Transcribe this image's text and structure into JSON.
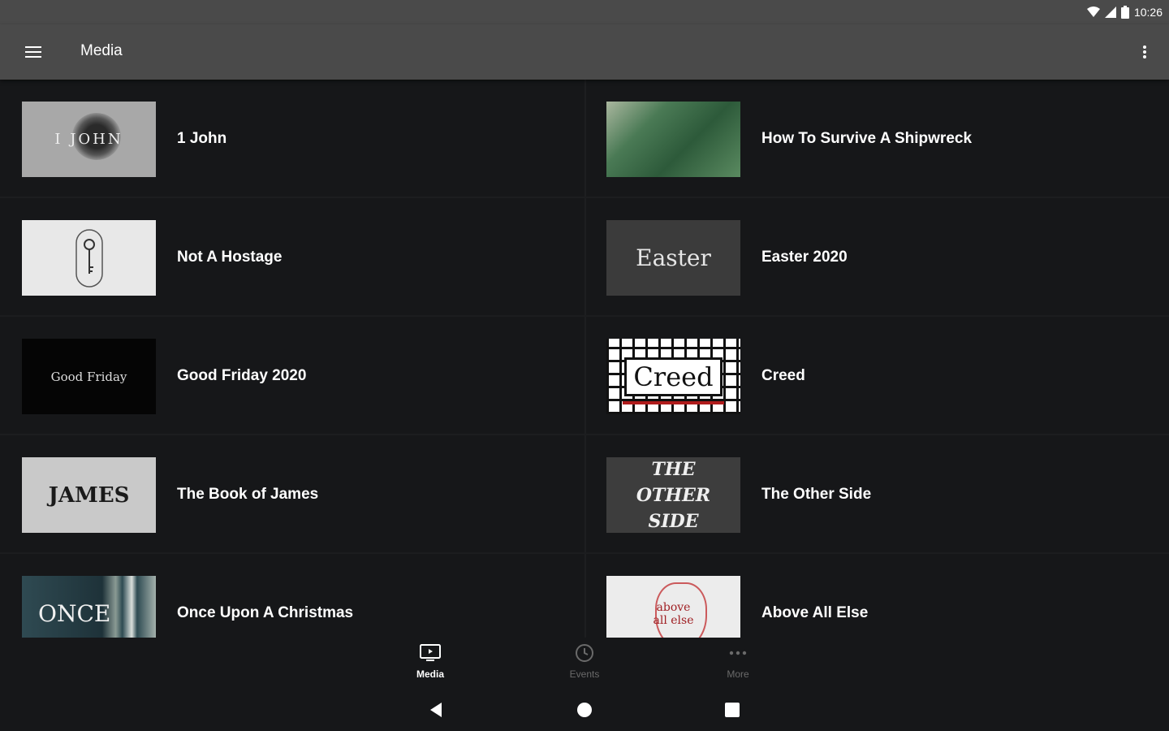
{
  "status_bar": {
    "time": "10:26"
  },
  "app_bar": {
    "title": "Media",
    "menu_icon": "hamburger-menu-icon",
    "overflow_icon": "more-vertical-icon"
  },
  "media_items": [
    {
      "title": "1 John",
      "thumb_text": "I JOHN"
    },
    {
      "title": "How To Survive A Shipwreck",
      "thumb_text": ""
    },
    {
      "title": "Not A Hostage",
      "thumb_text": ""
    },
    {
      "title": "Easter 2020",
      "thumb_text": "Easter"
    },
    {
      "title": "Good Friday 2020",
      "thumb_text": "Good Friday"
    },
    {
      "title": "Creed",
      "thumb_text": "Creed"
    },
    {
      "title": "The Book of James",
      "thumb_text": "JAMES"
    },
    {
      "title": "The Other Side",
      "thumb_text": "THE OTHER SIDE"
    },
    {
      "title": "Once Upon A Christmas",
      "thumb_text": "ONCE"
    },
    {
      "title": "Above All Else",
      "thumb_text": "above all else"
    }
  ],
  "bottom_nav": {
    "tabs": [
      {
        "label": "Media",
        "icon": "tv-icon",
        "active": true
      },
      {
        "label": "Events",
        "icon": "clock-icon",
        "active": false
      },
      {
        "label": "More",
        "icon": "more-horizontal-icon",
        "active": false
      }
    ]
  },
  "system_nav": {
    "back": "back-icon",
    "home": "home-icon",
    "recents": "recents-icon"
  },
  "colors": {
    "app_bar": "#4a4a4a",
    "background": "#161719",
    "active_tab": "#ffffff",
    "inactive_tab": "#6a6a6a"
  }
}
